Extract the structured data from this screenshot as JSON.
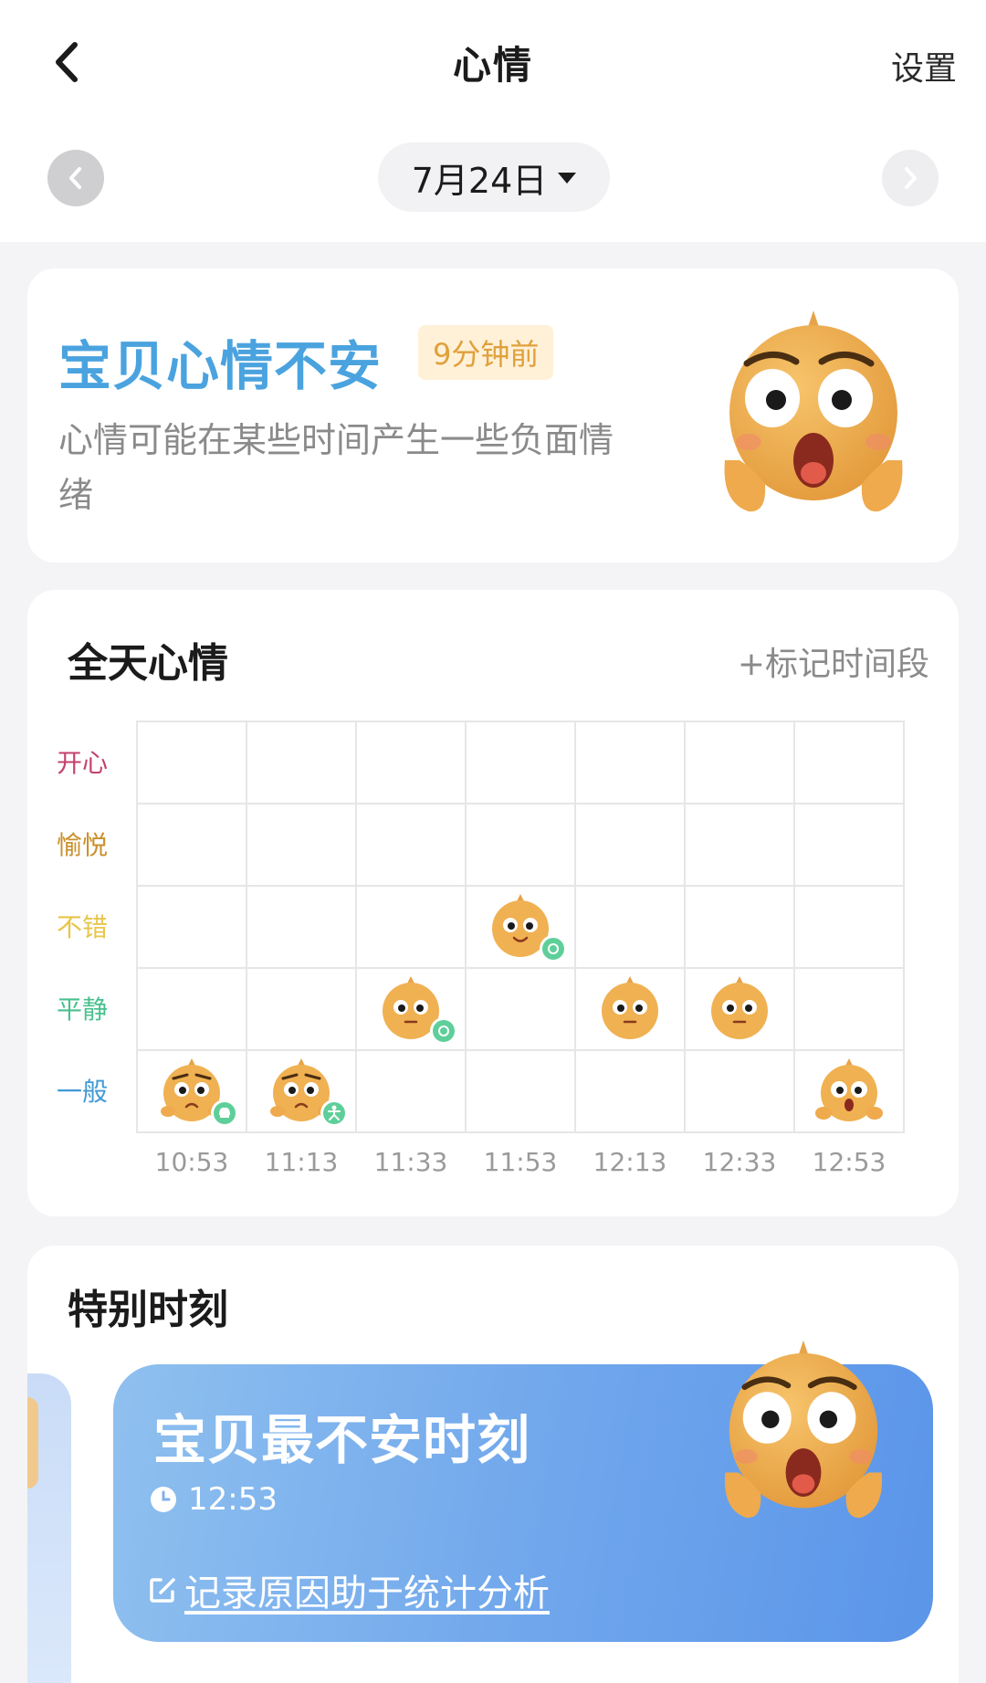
{
  "header": {
    "title": "心情",
    "settings_label": "设置",
    "date_label": "7月24日"
  },
  "status": {
    "headline": "宝贝心情不安",
    "time_badge": "9分钟前",
    "description": "心情可能在某些时间产生一些负面情绪",
    "mascot_mood": "anxious"
  },
  "chart": {
    "title": "全天心情",
    "mark_period_label": "+标记时间段"
  },
  "chart_data": {
    "type": "scatter",
    "title": "全天心情",
    "categories": [
      "10:53",
      "11:13",
      "11:33",
      "11:53",
      "12:13",
      "12:33",
      "12:53"
    ],
    "levels": [
      "开心",
      "愉悦",
      "不错",
      "平静",
      "一般"
    ],
    "level_colors": [
      "#c4426d",
      "#c9902c",
      "#e8c54a",
      "#49c08f",
      "#3f9ad6"
    ],
    "values": [
      "一般",
      "一般",
      "平静",
      "不错",
      "平静",
      "平静",
      "一般"
    ],
    "markers": [
      "food",
      "activity",
      "ok",
      "ok",
      null,
      null,
      null
    ],
    "mascot_faces": [
      "worried",
      "worried",
      "calm",
      "smile",
      "calm",
      "calm",
      "anxious"
    ],
    "grid": true
  },
  "moments": {
    "title": "特别时刻",
    "card": {
      "headline": "宝贝最不安时刻",
      "time": "12:53",
      "record_link": "记录原因助于统计分析",
      "clock_icon": "clock-icon",
      "edit_icon": "edit-icon"
    }
  },
  "colors": {
    "accent_blue": "#4aa3df",
    "badge_bg": "#fff1d7",
    "badge_text": "#e0a03c",
    "moment_gradient_start": "#8fc0ef",
    "moment_gradient_end": "#5b95e9"
  }
}
